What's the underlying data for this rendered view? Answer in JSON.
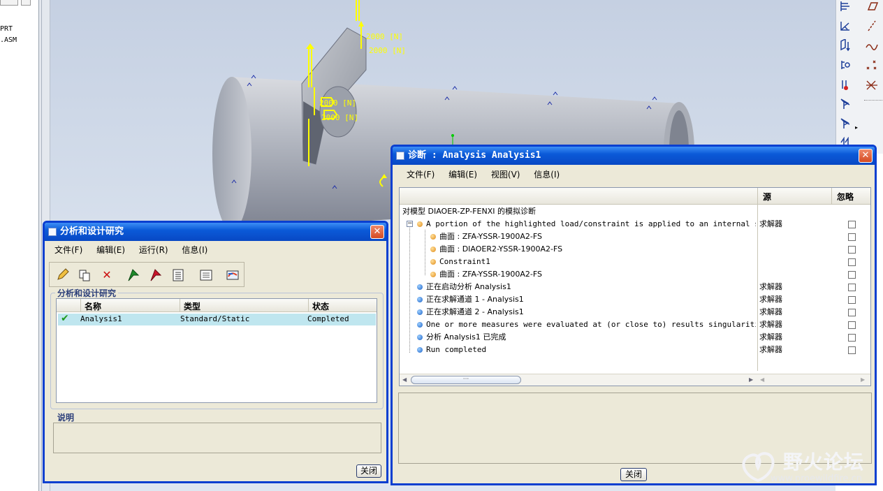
{
  "model_tree": {
    "items": [
      "PRT",
      ".ASM"
    ]
  },
  "viewport": {
    "annotations": [
      "2000 [N]",
      "2000 [N]",
      "2000 [N]",
      "2000 [N]"
    ]
  },
  "right_toolbar": {
    "icons": [
      "datum-plane-icon",
      "sketch-plane-icon",
      "datum-axis-icon",
      "datum-curve-icon",
      "coordinate-system-icon",
      "datum-point-icon",
      "thermometer-icon",
      "pattern-icon",
      "material-icon",
      "surface-region-icon"
    ]
  },
  "analysis_dialog": {
    "title": "分析和设计研究",
    "menu": [
      "文件(F)",
      "编辑(E)",
      "运行(R)",
      "信息(I)"
    ],
    "toolbar_icons": [
      "edit-pencil-icon",
      "copy-icon",
      "delete-icon",
      "start-flag-icon",
      "stop-flag-icon",
      "status-list-icon",
      "report-icon",
      "results-icon"
    ],
    "studies_group_label": "分析和设计研究",
    "columns": [
      "名称",
      "类型",
      "状态"
    ],
    "rows": [
      {
        "status_icon": "check-icon",
        "name": "Analysis1",
        "type": "Standard/Static",
        "state": "Completed"
      }
    ],
    "description_label": "说明",
    "close_label": "关闭"
  },
  "diagnostics_dialog": {
    "title": "诊断 : Analysis Analysis1",
    "menu": [
      "文件(F)",
      "编辑(E)",
      "视图(V)",
      "信息(I)"
    ],
    "columns": {
      "source": "源",
      "ignore": "忽略"
    },
    "root": "对模型 DIAOER-ZP-FENXI 的模拟诊断",
    "rows": [
      {
        "text": "A portion of the highlighted load/constraint is applied to an internal surface",
        "source": "求解器",
        "level": 1,
        "bullet": "orange",
        "expanded": true
      },
      {
        "text": "曲面 : ZFA-YSSR-1900A2-FS",
        "source": "",
        "level": 2,
        "bullet": "orange"
      },
      {
        "text": "曲面 : DIAOER2-YSSR-1900A2-FS",
        "source": "",
        "level": 2,
        "bullet": "orange"
      },
      {
        "text": "Constraint1",
        "source": "",
        "level": 2,
        "bullet": "orange"
      },
      {
        "text": "曲面 : ZFA-YSSR-1900A2-FS",
        "source": "",
        "level": 2,
        "bullet": "orange"
      },
      {
        "text": "正在启动分析 Analysis1",
        "source": "求解器",
        "level": 1,
        "bullet": "blue"
      },
      {
        "text": "正在求解通道 1 - Analysis1",
        "source": "求解器",
        "level": 1,
        "bullet": "blue"
      },
      {
        "text": "正在求解通道 2 - Analysis1",
        "source": "求解器",
        "level": 1,
        "bullet": "blue"
      },
      {
        "text": "One or more measures were evaluated at (or close to) results singularities. Th",
        "source": "求解器",
        "level": 1,
        "bullet": "blue"
      },
      {
        "text": "分析 Analysis1 已完成",
        "source": "求解器",
        "level": 1,
        "bullet": "blue"
      },
      {
        "text": "Run completed",
        "source": "求解器",
        "level": 1,
        "bullet": "blue"
      }
    ],
    "scroll_thumb_label": "···",
    "close_label": "关闭"
  },
  "watermark": {
    "text": "野火论坛",
    "url": "www.proewildfire.cn"
  },
  "colors": {
    "title_blue": "#0b5ad8",
    "dialog_bg": "#ece9d8",
    "selected_row": "#bfe6ef",
    "annotation_yellow": "#ffff00"
  }
}
